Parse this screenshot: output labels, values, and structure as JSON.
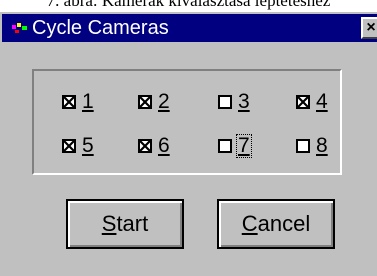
{
  "caption": "7. ábra: Kamerák kiválasztása léptetéshez",
  "window": {
    "title": "Cycle Cameras",
    "close_glyph": "×"
  },
  "cameras": [
    {
      "label": "1",
      "checked": true
    },
    {
      "label": "2",
      "checked": true
    },
    {
      "label": "3",
      "checked": false
    },
    {
      "label": "4",
      "checked": true
    },
    {
      "label": "5",
      "checked": true
    },
    {
      "label": "6",
      "checked": true
    },
    {
      "label": "7",
      "checked": false,
      "focused": true
    },
    {
      "label": "8",
      "checked": false
    }
  ],
  "buttons": {
    "start": {
      "mnemonic": "S",
      "rest": "tart"
    },
    "cancel": {
      "mnemonic": "C",
      "rest": "ancel"
    }
  },
  "colors": {
    "titlebar": "#000080",
    "face": "#c0c0c0"
  },
  "icons": {
    "system_menu": "app-system-menu-icon",
    "close": "close-icon",
    "check": "check-x-mark"
  }
}
